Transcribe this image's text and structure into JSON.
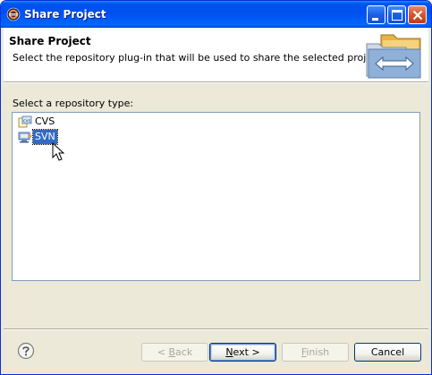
{
  "window": {
    "title": "Share Project"
  },
  "header": {
    "title": "Share Project",
    "description": "Select the repository plug-in that will be used to share the selected project."
  },
  "repository": {
    "label": "Select a repository type:",
    "items": [
      {
        "label": "CVS",
        "icon": "cvs-repository-icon",
        "selected": false
      },
      {
        "label": "SVN",
        "icon": "svn-repository-icon",
        "selected": true
      }
    ]
  },
  "buttons": {
    "back": {
      "prefix": "< ",
      "mnemonic": "B",
      "rest": "ack",
      "enabled": false
    },
    "next": {
      "mnemonic": "N",
      "rest": "ext >",
      "enabled": true
    },
    "finish": {
      "mnemonic": "F",
      "rest": "inish",
      "enabled": false
    },
    "cancel": {
      "label": "Cancel",
      "enabled": true
    }
  },
  "colors": {
    "titlebar": "#0053ee",
    "selection": "#316ac5",
    "dialog_bg": "#ece9d8"
  }
}
